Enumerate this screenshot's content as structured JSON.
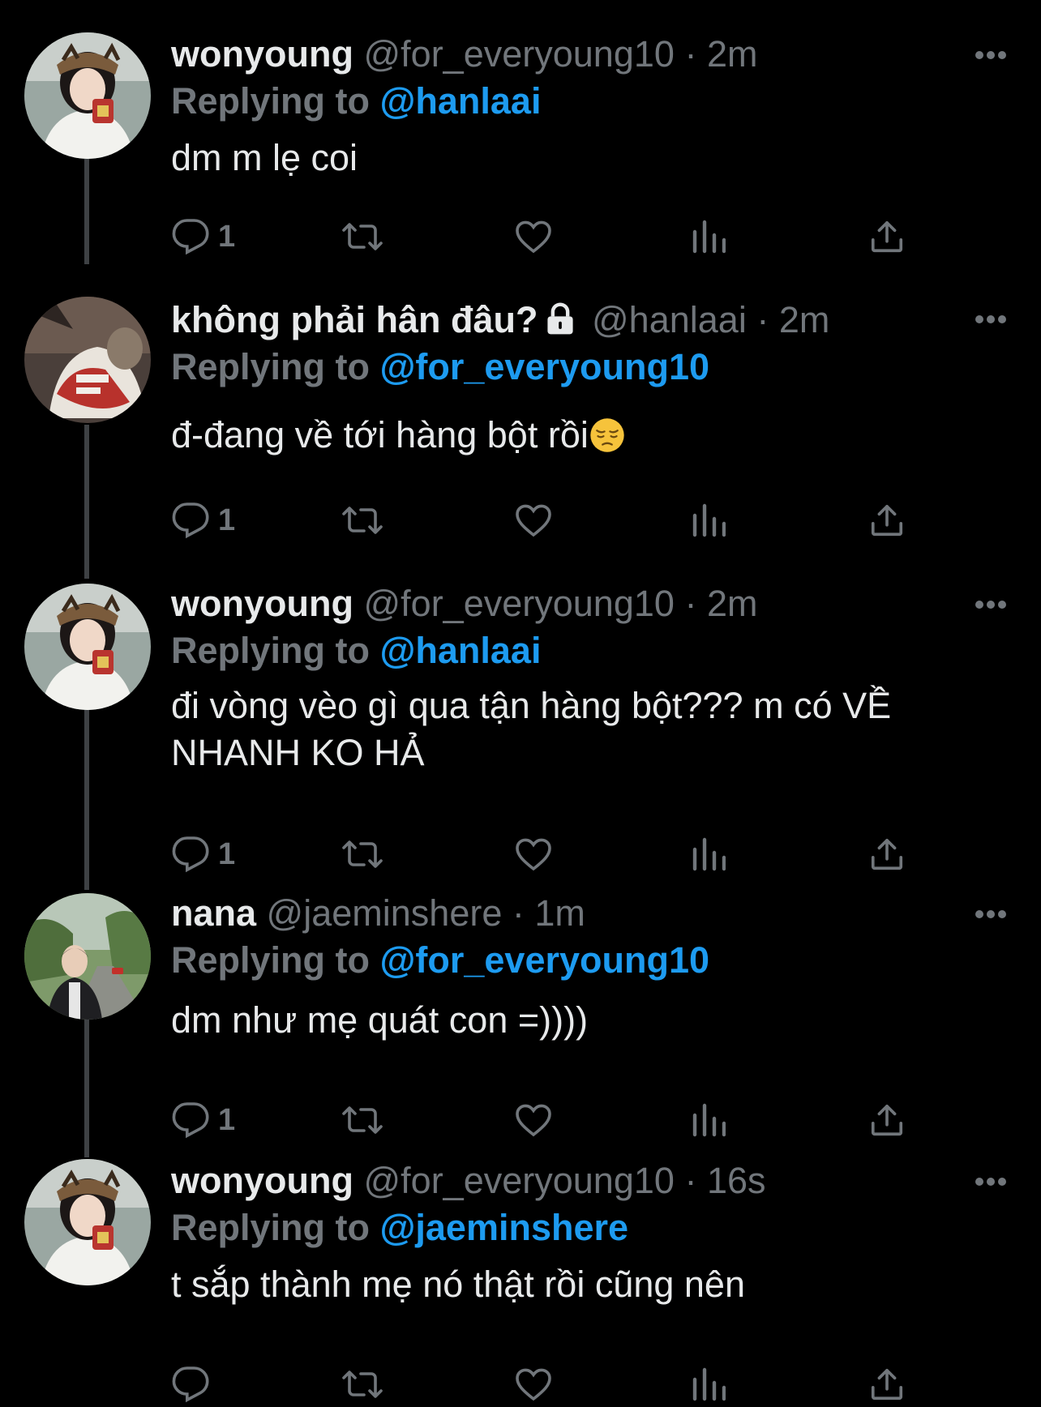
{
  "thread": {
    "tweets": [
      {
        "name": "wonyoung",
        "handle": "@for_everyoung10",
        "separator": "·",
        "time": "2m",
        "replying_label": "Replying to",
        "replying_to": "@hanlaai",
        "text": "dm m lẹ coi",
        "reply_count": "1",
        "avatar": "wonyoung-avatar"
      },
      {
        "name": "không phải hân đâu?",
        "handle": "@hanlaai",
        "separator": "·",
        "time": "2m",
        "replying_label": "Replying to",
        "replying_to": "@for_everyoung10",
        "text": "đ-đang về tới hàng bột rồi",
        "reply_count": "1",
        "avatar": "hanlaai-avatar",
        "locked": "lock-icon",
        "emoji": "pensive-face-emoji"
      },
      {
        "name": "wonyoung",
        "handle": "@for_everyoung10",
        "separator": "·",
        "time": "2m",
        "replying_label": "Replying to",
        "replying_to": "@hanlaai",
        "text_line1": "đi vòng vèo gì qua tận hàng bột??? m có VỀ",
        "text_line2": "NHANH KO HẢ",
        "reply_count": "1",
        "avatar": "wonyoung-avatar"
      },
      {
        "name": "nana",
        "handle": "@jaeminshere",
        "separator": "·",
        "time": "1m",
        "replying_label": "Replying to",
        "replying_to": "@for_everyoung10",
        "text": "dm như mẹ quát con =))))",
        "reply_count": "1",
        "avatar": "jaeminshere-avatar"
      },
      {
        "name": "wonyoung",
        "handle": "@for_everyoung10",
        "separator": "·",
        "time": "16s",
        "replying_label": "Replying to",
        "replying_to": "@jaeminshere",
        "text": "t sắp thành mẹ nó thật rồi cũng nên",
        "reply_count": "",
        "avatar": "wonyoung-avatar"
      }
    ]
  },
  "icons": {
    "more": "more-horizontal-icon",
    "reply": "reply-bubble-icon",
    "retweet": "retweet-icon",
    "like": "heart-icon",
    "views": "views-chart-icon",
    "share": "share-upload-icon"
  },
  "colors": {
    "background": "#000000",
    "primary_text": "#e7e9ea",
    "secondary_text": "#71767b",
    "link": "#1d9bf0",
    "thread_line": "#3e4144"
  }
}
